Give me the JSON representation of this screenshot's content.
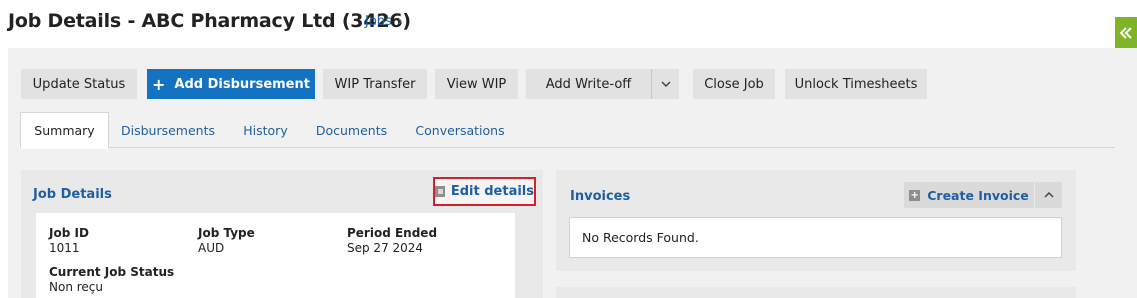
{
  "header": {
    "title": "Job Details - ABC Pharmacy Ltd (3426)",
    "breadcrumb": {
      "label": "Jobs",
      "separator": "›"
    },
    "side_toggle_icon": "double-chevron-left-icon"
  },
  "toolbar": {
    "update_status": "Update Status",
    "add_disbursement": "Add Disbursement",
    "wip_transfer": "WIP Transfer",
    "view_wip": "View WIP",
    "add_writeoff": "Add Write-off",
    "close_job": "Close Job",
    "unlock_timesheets": "Unlock Timesheets"
  },
  "tabs": [
    {
      "label": "Summary",
      "active": true
    },
    {
      "label": "Disbursements",
      "active": false
    },
    {
      "label": "History",
      "active": false
    },
    {
      "label": "Documents",
      "active": false
    },
    {
      "label": "Conversations",
      "active": false
    }
  ],
  "job_details": {
    "title": "Job Details",
    "edit_label": "Edit details",
    "fields": {
      "job_id": {
        "label": "Job ID",
        "value": "1011"
      },
      "job_type": {
        "label": "Job Type",
        "value": "AUD"
      },
      "period_ended": {
        "label": "Period Ended",
        "value": "Sep 27 2024"
      },
      "status": {
        "label": "Current Job Status",
        "value": "Non reçu"
      }
    }
  },
  "invoices": {
    "title": "Invoices",
    "create_label": "Create Invoice",
    "empty_text": "No Records Found."
  },
  "colors": {
    "primary": "#1372c2",
    "link": "#1f5f9e",
    "accent_green": "#7fb426",
    "highlight_red": "#d3202a"
  }
}
